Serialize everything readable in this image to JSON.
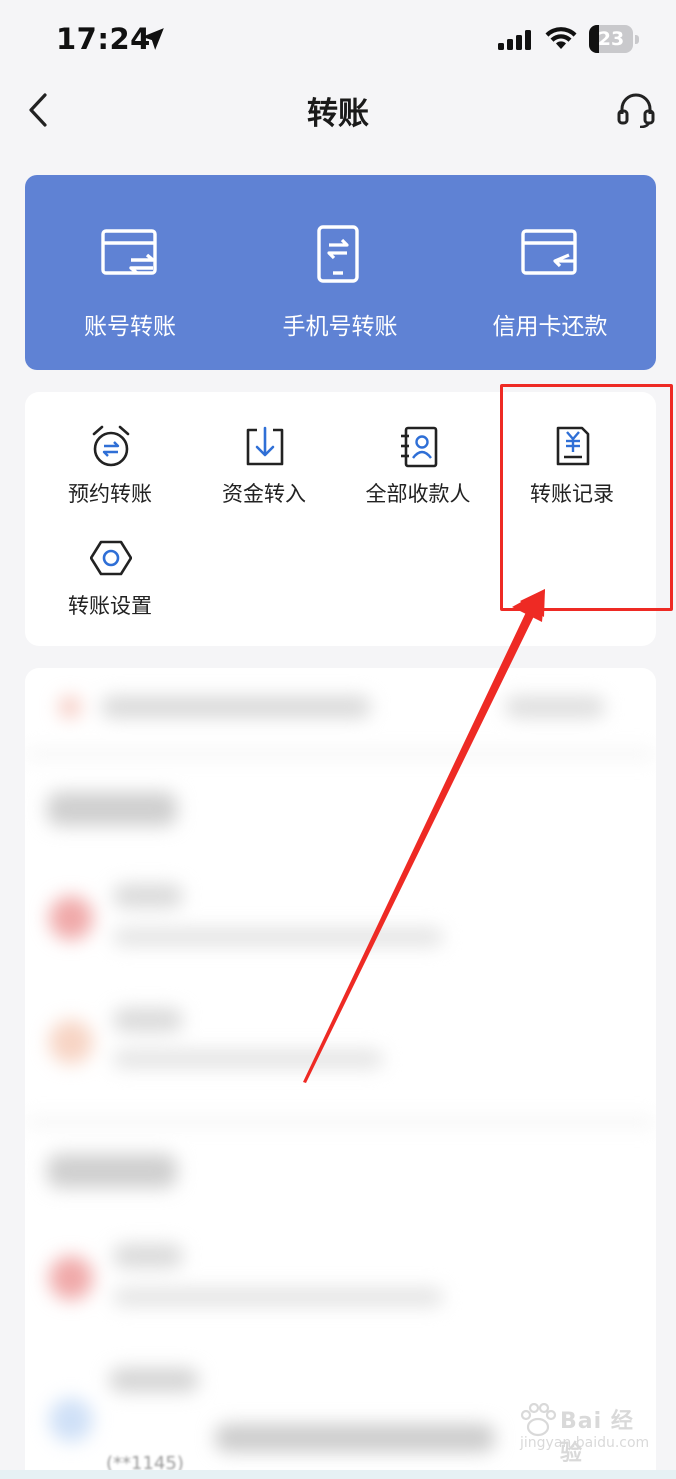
{
  "status_bar": {
    "time": "17:24",
    "battery": "23",
    "battery_level": 0.23
  },
  "nav": {
    "title": "转账"
  },
  "hero": {
    "items": [
      {
        "label": "账号转账",
        "icon": "card-transfer-icon"
      },
      {
        "label": "手机号转账",
        "icon": "phone-transfer-icon"
      },
      {
        "label": "信用卡还款",
        "icon": "credit-card-repay-icon"
      }
    ]
  },
  "services": {
    "items": [
      {
        "label": "预约转账",
        "icon": "alarm-clock-icon"
      },
      {
        "label": "资金转入",
        "icon": "download-box-icon"
      },
      {
        "label": "全部收款人",
        "icon": "contact-book-icon"
      },
      {
        "label": "转账记录",
        "icon": "yuan-receipt-icon"
      },
      {
        "label": "转账设置",
        "icon": "hexagon-settings-icon"
      }
    ]
  },
  "watermark": {
    "main": "Bai 经验",
    "sub": "jingyan.baidu.com"
  },
  "bottom": {
    "text": "(**1145)"
  },
  "colors": {
    "hero_bg": "#5f82d4",
    "accent_icon": "#2f6fd6",
    "highlight": "#ee2a24"
  }
}
